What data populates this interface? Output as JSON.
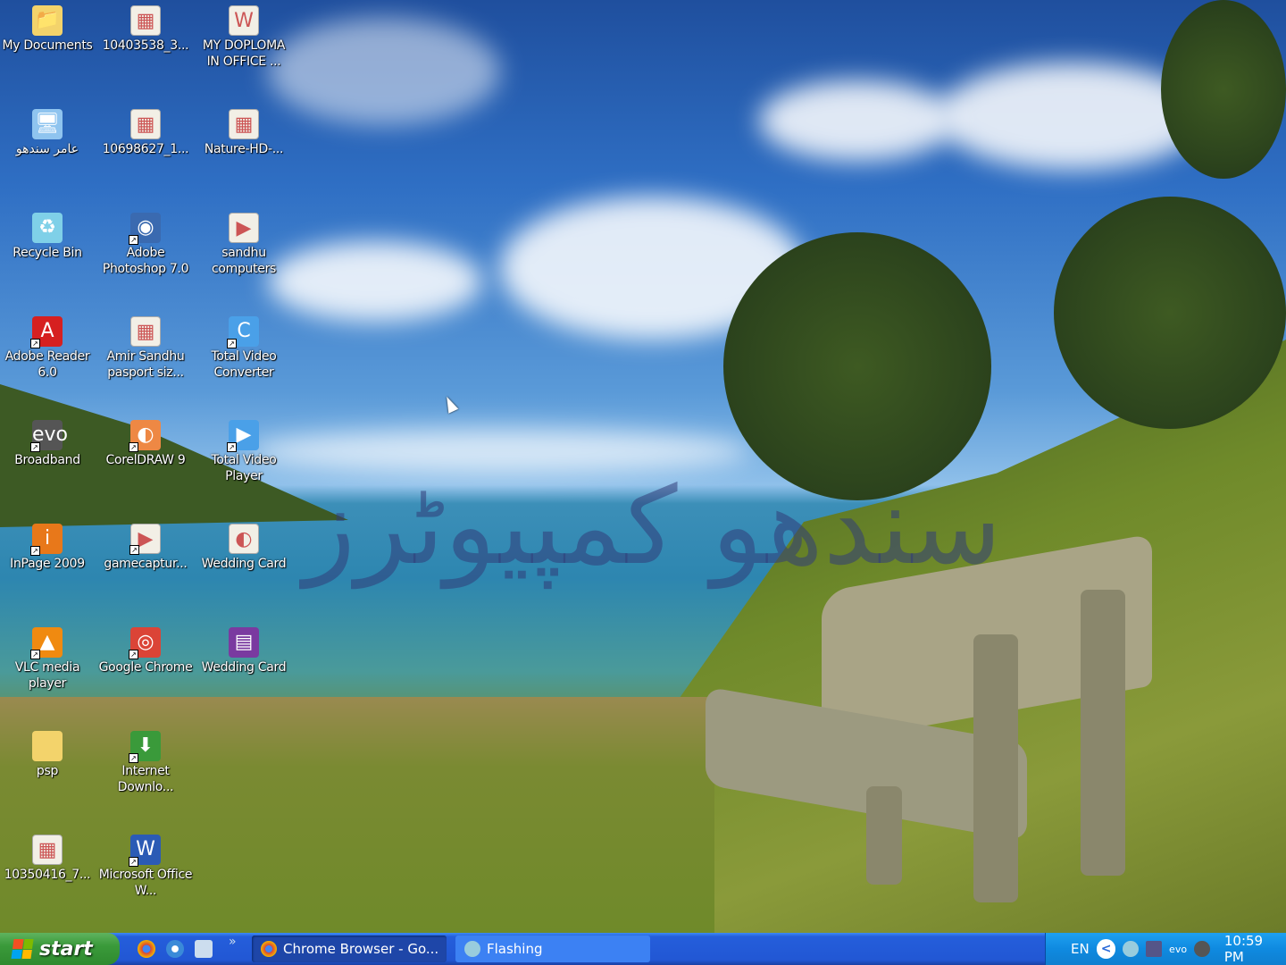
{
  "desktop": {
    "watermark": "سندھو کمپیوٹرز",
    "icons": [
      {
        "label": "My Documents",
        "icon": "folder-documents-icon",
        "color": "#f3d36b",
        "glyph": "📁",
        "shortcut": false
      },
      {
        "label": "عامر سندھو",
        "icon": "my-computer-icon",
        "color": "#8fc4ef",
        "glyph": "🖥",
        "shortcut": false
      },
      {
        "label": "Recycle Bin",
        "icon": "recycle-bin-icon",
        "color": "#7fd0e8",
        "glyph": "♻",
        "shortcut": false
      },
      {
        "label": "Adobe Reader 6.0",
        "icon": "adobe-reader-icon",
        "color": "#d62020",
        "glyph": "A",
        "shortcut": true
      },
      {
        "label": "Broadband",
        "icon": "broadband-icon",
        "color": "#555",
        "glyph": "evo",
        "shortcut": true
      },
      {
        "label": "InPage 2009",
        "icon": "inpage-icon",
        "color": "#e8781a",
        "glyph": "i",
        "shortcut": true
      },
      {
        "label": "VLC media player",
        "icon": "vlc-icon",
        "color": "#f08a10",
        "glyph": "▲",
        "shortcut": true
      },
      {
        "label": "psp",
        "icon": "folder-icon",
        "color": "#f3d36b",
        "glyph": "",
        "shortcut": false
      },
      {
        "label": "10350416_7...",
        "icon": "image-file-icon",
        "color": "#f2efe6",
        "glyph": "▦",
        "shortcut": false
      },
      {
        "label": "10403538_3...",
        "icon": "image-file-icon",
        "color": "#f2efe6",
        "glyph": "▦",
        "shortcut": false
      },
      {
        "label": "10698627_1...",
        "icon": "image-file-icon",
        "color": "#f2efe6",
        "glyph": "▦",
        "shortcut": false
      },
      {
        "label": "Adobe Photoshop 7.0",
        "icon": "photoshop-icon",
        "color": "#3a6ab0",
        "glyph": "◉",
        "shortcut": true
      },
      {
        "label": "Amir Sandhu pasport siz...",
        "icon": "image-file-icon",
        "color": "#f2efe6",
        "glyph": "▦",
        "shortcut": false
      },
      {
        "label": "CorelDRAW 9",
        "icon": "coreldraw-icon",
        "color": "#e84",
        "glyph": "◐",
        "shortcut": true
      },
      {
        "label": "gamecaptur...",
        "icon": "video-file-icon",
        "color": "#f2efe6",
        "glyph": "▶",
        "shortcut": true
      },
      {
        "label": "Google Chrome",
        "icon": "chrome-icon",
        "color": "#db4437",
        "glyph": "◎",
        "shortcut": true
      },
      {
        "label": "Internet Downlo...",
        "icon": "internet-download-manager-icon",
        "color": "#3a9a3a",
        "glyph": "⬇",
        "shortcut": true
      },
      {
        "label": "Microsoft Office W...",
        "icon": "word-icon",
        "color": "#2b5bb5",
        "glyph": "W",
        "shortcut": true
      },
      {
        "label": "MY DOPLOMA IN OFFICE ...",
        "icon": "word-document-icon",
        "color": "#f2efe6",
        "glyph": "W",
        "shortcut": false
      },
      {
        "label": "Nature-HD-...",
        "icon": "image-file-icon",
        "color": "#f2efe6",
        "glyph": "▦",
        "shortcut": false
      },
      {
        "label": "sandhu computers",
        "icon": "video-file-icon",
        "color": "#f2efe6",
        "glyph": "▶",
        "shortcut": false
      },
      {
        "label": "Total Video Converter",
        "icon": "total-video-converter-icon",
        "color": "#4aa0e8",
        "glyph": "C",
        "shortcut": true
      },
      {
        "label": "Total Video Player",
        "icon": "total-video-player-icon",
        "color": "#4aa0e8",
        "glyph": "▶",
        "shortcut": true
      },
      {
        "label": "Wedding Card",
        "icon": "coreldraw-file-icon",
        "color": "#f2efe6",
        "glyph": "◐",
        "shortcut": false
      },
      {
        "label": "Wedding Card",
        "icon": "winrar-archive-icon",
        "color": "#7a3aa0",
        "glyph": "▤",
        "shortcut": false
      }
    ]
  },
  "taskbar": {
    "start_label": "start",
    "quick_launch": [
      {
        "name": "chrome",
        "color": "#db4437"
      },
      {
        "name": "internet-explorer",
        "color": "#3a8ad8"
      },
      {
        "name": "show-desktop",
        "color": "#cde"
      }
    ],
    "overflow": "»",
    "tasks": [
      {
        "label": "Chrome Browser - Go...",
        "active": true,
        "color": "#db4437"
      },
      {
        "label": "Flashing",
        "active": false,
        "color": "#9cd"
      }
    ],
    "tray": {
      "language": "EN",
      "show_hidden": "<",
      "clock": "10:59 PM"
    }
  }
}
